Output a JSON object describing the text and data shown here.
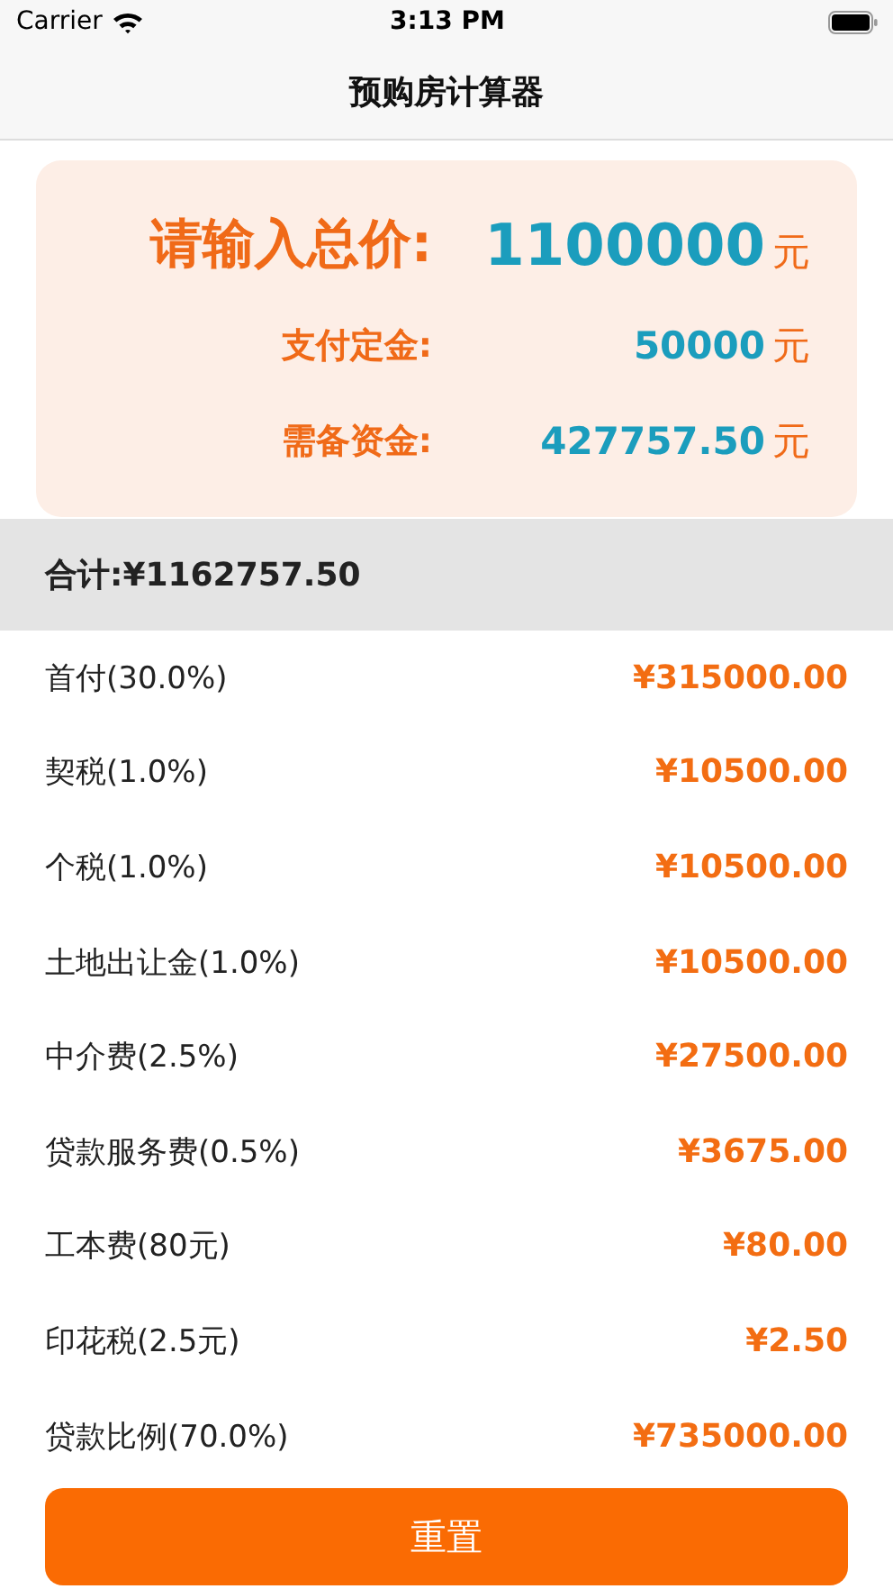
{
  "status_bar": {
    "carrier": "Carrier",
    "time": "3:13 PM"
  },
  "nav": {
    "title": "预购房计算器"
  },
  "summary": [
    {
      "label": "请输入总价:",
      "value": "1100000",
      "unit": "元",
      "kind": "input"
    },
    {
      "label": "支付定金:",
      "value": "50000",
      "unit": "元",
      "kind": "output"
    },
    {
      "label": "需备资金:",
      "value": "427757.50",
      "unit": "元",
      "kind": "output"
    }
  ],
  "total": "合计:¥1162757.50",
  "rows": [
    {
      "label": "首付(30.0%)",
      "amount": "¥315000.00"
    },
    {
      "label": "契税(1.0%)",
      "amount": "¥10500.00"
    },
    {
      "label": "个税(1.0%)",
      "amount": "¥10500.00"
    },
    {
      "label": "土地出让金(1.0%)",
      "amount": "¥10500.00"
    },
    {
      "label": "中介费(2.5%)",
      "amount": "¥27500.00"
    },
    {
      "label": "贷款服务费(0.5%)",
      "amount": "¥3675.00"
    },
    {
      "label": "工本费(80元)",
      "amount": "¥80.00"
    },
    {
      "label": "印花税(2.5元)",
      "amount": "¥2.50"
    },
    {
      "label": "贷款比例(70.0%)",
      "amount": "¥735000.00"
    }
  ],
  "reset_button": "重置"
}
